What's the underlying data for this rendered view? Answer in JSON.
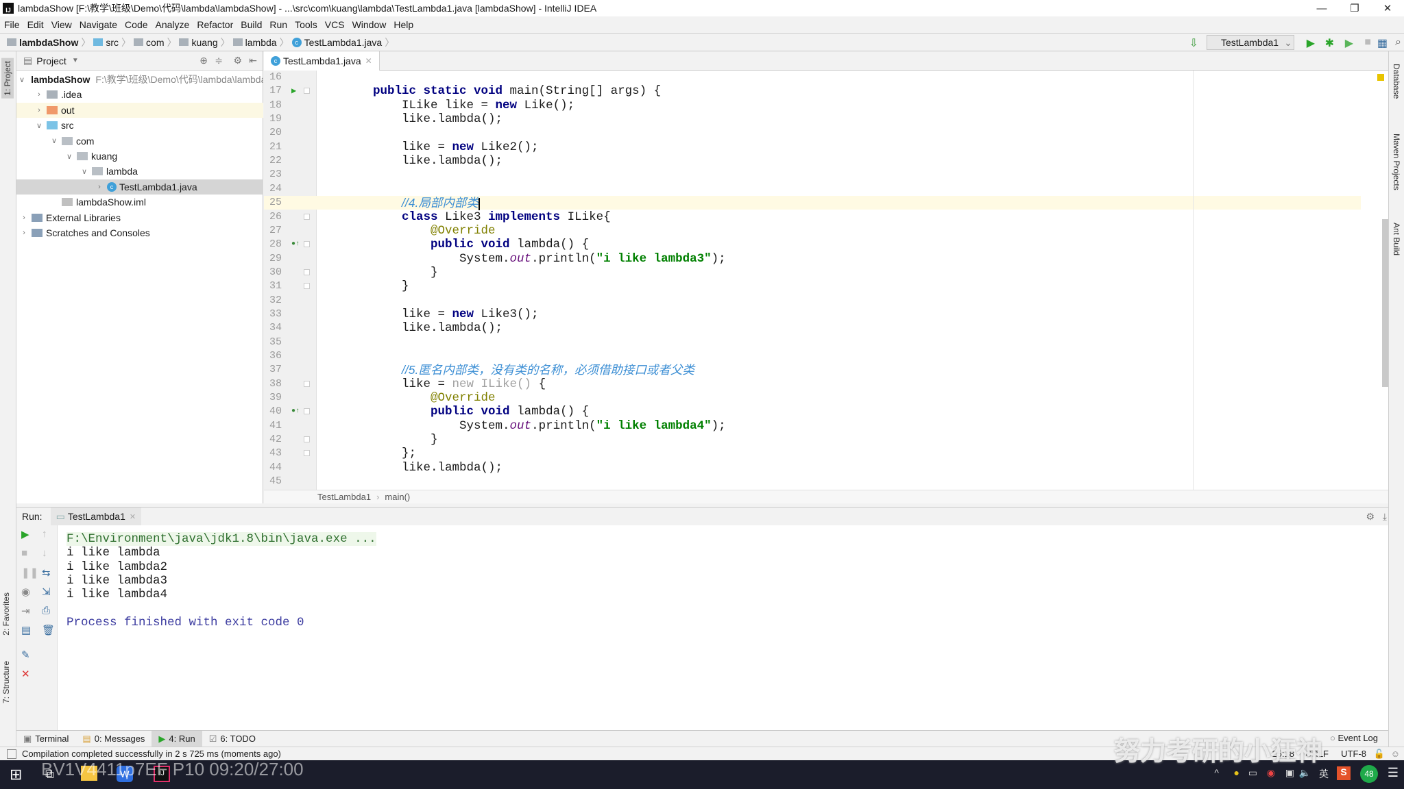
{
  "window": {
    "title": "lambdaShow [F:\\教学\\班级\\Demo\\代码\\lambda\\lambdaShow] - ...\\src\\com\\kuang\\lambda\\TestLambda1.java [lambdaShow] - IntelliJ IDEA",
    "minimize": "—",
    "restore": "❐",
    "close": "✕"
  },
  "menu": [
    "File",
    "Edit",
    "View",
    "Navigate",
    "Code",
    "Analyze",
    "Refactor",
    "Build",
    "Run",
    "Tools",
    "VCS",
    "Window",
    "Help"
  ],
  "breadcrumb": [
    "lambdaShow",
    "src",
    "com",
    "kuang",
    "lambda",
    "TestLambda1.java"
  ],
  "toolbar": {
    "run_config": "TestLambda1"
  },
  "left_strip": {
    "project": "1: Project",
    "favorites": "2: Favorites",
    "structure": "7: Structure"
  },
  "right_strip": [
    "Database",
    "Maven Projects",
    "Ant Build"
  ],
  "project": {
    "header": "Project",
    "tree": [
      {
        "label": "lambdaShow",
        "path": "F:\\教学\\班级\\Demo\\代码\\lambda\\lambdaShow",
        "depth": 0,
        "expanded": true,
        "type": "module",
        "bold": true
      },
      {
        "label": ".idea",
        "depth": 1,
        "expanded": false,
        "type": "folder"
      },
      {
        "label": "out",
        "depth": 1,
        "expanded": false,
        "type": "excluded"
      },
      {
        "label": "src",
        "depth": 1,
        "expanded": true,
        "type": "source"
      },
      {
        "label": "com",
        "depth": 2,
        "expanded": true,
        "type": "package"
      },
      {
        "label": "kuang",
        "depth": 3,
        "expanded": true,
        "type": "package"
      },
      {
        "label": "lambda",
        "depth": 4,
        "expanded": true,
        "type": "package"
      },
      {
        "label": "TestLambda1.java",
        "depth": 5,
        "expanded": false,
        "type": "class",
        "selected": true
      },
      {
        "label": "lambdaShow.iml",
        "depth": 2,
        "type": "iml"
      },
      {
        "label": "External Libraries",
        "depth": 0,
        "expanded": false,
        "type": "lib"
      },
      {
        "label": "Scratches and Consoles",
        "depth": 0,
        "expanded": false,
        "type": "scratch"
      }
    ]
  },
  "editor": {
    "tab": "TestLambda1.java",
    "current_line": 25,
    "lines": [
      {
        "n": 16,
        "t": []
      },
      {
        "n": 17,
        "g": "run",
        "t": [
          [
            "    ",
            ""
          ],
          [
            "public static void",
            "kw"
          ],
          [
            " main(String[] args) {",
            ""
          ]
        ]
      },
      {
        "n": 18,
        "t": [
          [
            "        ILike like = ",
            ""
          ],
          [
            "new",
            "kw"
          ],
          [
            " Like();",
            ""
          ]
        ]
      },
      {
        "n": 19,
        "t": [
          [
            "        like.lambda();",
            ""
          ]
        ]
      },
      {
        "n": 20,
        "t": []
      },
      {
        "n": 21,
        "t": [
          [
            "        like = ",
            ""
          ],
          [
            "new",
            "kw"
          ],
          [
            " Like2();",
            ""
          ]
        ]
      },
      {
        "n": 22,
        "t": [
          [
            "        like.lambda();",
            ""
          ]
        ]
      },
      {
        "n": 23,
        "t": []
      },
      {
        "n": 24,
        "t": []
      },
      {
        "n": 25,
        "t": [
          [
            "        ",
            ""
          ],
          [
            "//4.局部内部类",
            "cm"
          ]
        ]
      },
      {
        "n": 26,
        "t": [
          [
            "        ",
            ""
          ],
          [
            "class",
            "kw"
          ],
          [
            " Like3 ",
            ""
          ],
          [
            "implements",
            "kw"
          ],
          [
            " ILike{",
            ""
          ]
        ]
      },
      {
        "n": 27,
        "t": [
          [
            "            ",
            ""
          ],
          [
            "@Override",
            "ann"
          ]
        ]
      },
      {
        "n": 28,
        "g": "override",
        "t": [
          [
            "            ",
            ""
          ],
          [
            "public void",
            "kw"
          ],
          [
            " lambda() {",
            ""
          ]
        ]
      },
      {
        "n": 29,
        "t": [
          [
            "                System.",
            ""
          ],
          [
            "out",
            "it"
          ],
          [
            ".println(",
            ""
          ],
          [
            "\"i like lambda3\"",
            "str"
          ],
          [
            ");",
            ""
          ]
        ]
      },
      {
        "n": 30,
        "t": [
          [
            "            }",
            ""
          ]
        ]
      },
      {
        "n": 31,
        "t": [
          [
            "        }",
            ""
          ]
        ]
      },
      {
        "n": 32,
        "t": []
      },
      {
        "n": 33,
        "t": [
          [
            "        like = ",
            ""
          ],
          [
            "new",
            "kw"
          ],
          [
            " Like3();",
            ""
          ]
        ]
      },
      {
        "n": 34,
        "t": [
          [
            "        like.lambda();",
            ""
          ]
        ]
      },
      {
        "n": 35,
        "t": []
      },
      {
        "n": 36,
        "t": []
      },
      {
        "n": 37,
        "t": [
          [
            "        ",
            ""
          ],
          [
            "//5.匿名内部类，没有类的名称，必须借助接口或者父类",
            "cm"
          ]
        ]
      },
      {
        "n": 38,
        "t": [
          [
            "        like = ",
            ""
          ],
          [
            "new ILike()",
            "dim"
          ],
          [
            " {",
            ""
          ]
        ]
      },
      {
        "n": 39,
        "t": [
          [
            "            ",
            ""
          ],
          [
            "@Override",
            "ann"
          ]
        ]
      },
      {
        "n": 40,
        "g": "override",
        "t": [
          [
            "            ",
            ""
          ],
          [
            "public void",
            "kw"
          ],
          [
            " lambda() {",
            ""
          ]
        ]
      },
      {
        "n": 41,
        "t": [
          [
            "                System.",
            ""
          ],
          [
            "out",
            "it"
          ],
          [
            ".println(",
            ""
          ],
          [
            "\"i like lambda4\"",
            "str"
          ],
          [
            ");",
            ""
          ]
        ]
      },
      {
        "n": 42,
        "t": [
          [
            "            }",
            ""
          ]
        ]
      },
      {
        "n": 43,
        "t": [
          [
            "        };",
            ""
          ]
        ]
      },
      {
        "n": 44,
        "t": [
          [
            "        like.lambda();",
            ""
          ]
        ]
      },
      {
        "n": 45,
        "t": []
      }
    ],
    "breadcrumb": [
      "TestLambda1",
      "main()"
    ]
  },
  "run": {
    "label": "Run:",
    "tab": "TestLambda1",
    "console": [
      {
        "text": "F:\\Environment\\java\\jdk1.8\\bin\\java.exe ...",
        "color": "#2d6e2d"
      },
      {
        "text": "i like lambda",
        "color": "#1a1a1a"
      },
      {
        "text": "i like lambda2",
        "color": "#1a1a1a"
      },
      {
        "text": "i like lambda3",
        "color": "#1a1a1a"
      },
      {
        "text": "i like lambda4",
        "color": "#1a1a1a"
      },
      {
        "text": "",
        "color": "#1a1a1a"
      },
      {
        "text": "Process finished with exit code 0",
        "color": "#3c3ca0"
      }
    ]
  },
  "bottom_tabs": [
    {
      "label": "Terminal"
    },
    {
      "label": "0: Messages"
    },
    {
      "label": "4: Run",
      "active": true
    },
    {
      "label": "6: TODO"
    }
  ],
  "event_log": "Event Log",
  "status": {
    "message": "Compilation completed successfully in 2 s 725 ms (moments ago)",
    "position": "25:18",
    "line_sep": "CRLF",
    "encoding": "UTF-8"
  },
  "overlay": {
    "video": "BV1V4411p7EF P10 09:20/27:00",
    "author": "努力考研的小狂神"
  },
  "taskbar": {
    "ime": "英",
    "badge": "48"
  }
}
